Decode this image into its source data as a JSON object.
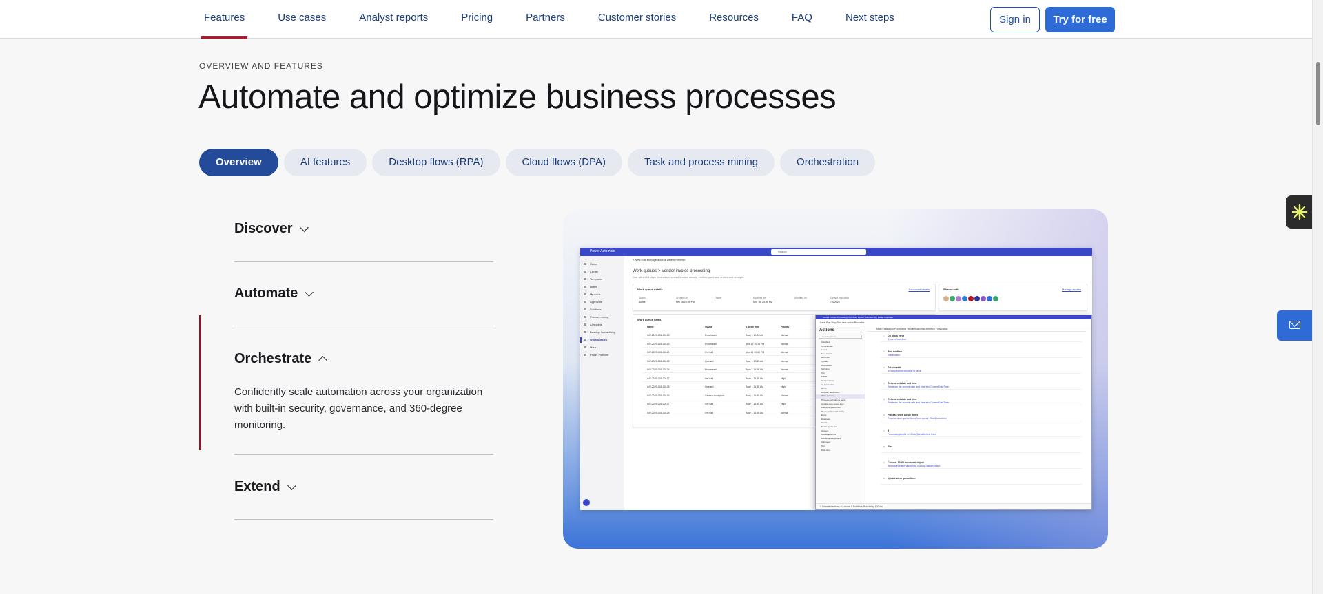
{
  "nav": {
    "links": [
      "Features",
      "Use cases",
      "Analyst reports",
      "Pricing",
      "Partners",
      "Customer stories",
      "Resources",
      "FAQ",
      "Next steps"
    ],
    "active": "Features",
    "signin_label": "Sign in",
    "try_label": "Try for free"
  },
  "hero": {
    "eyebrow": "OVERVIEW AND FEATURES",
    "title": "Automate and optimize business processes"
  },
  "tabs": {
    "items": [
      "Overview",
      "AI features",
      "Desktop flows (RPA)",
      "Cloud flows (DPA)",
      "Task and process mining",
      "Orchestration"
    ],
    "active": "Overview"
  },
  "accordion": {
    "items": [
      {
        "title": "Discover",
        "open": false
      },
      {
        "title": "Automate",
        "open": false
      },
      {
        "title": "Orchestrate",
        "open": true,
        "body": "Confidently scale automation across your organization with built-in security, governance, and 360-degree monitoring."
      },
      {
        "title": "Extend",
        "open": false
      }
    ]
  },
  "screenshot": {
    "app_name": "Power Automate",
    "search_placeholder": "Search",
    "toolbar": "+ New   Edit   Manage access   Delete   Refresh",
    "breadcrumb": "Work queues  >  Vendor invoice processing",
    "breadcrumb_sub": "Due within 14 days. Includes received invoice details, verified purchase orders and receipts.",
    "sidebar": [
      "Home",
      "Create",
      "Templates",
      "Learn",
      "My flows",
      "Approvals",
      "Solutions",
      "Process mining",
      "AI models",
      "Desktop flow activity",
      "Work queues",
      "More",
      "Power Platform"
    ],
    "sidebar_selected": "Work queues",
    "details_title": "Work queue details",
    "details_link": "Advanced details",
    "shared_title": "Shared with",
    "shared_link": "Manage access",
    "details": [
      {
        "label": "Status",
        "value": "Active"
      },
      {
        "label": "Created on",
        "value": "Feb 26 20:59 PM"
      },
      {
        "label": "Owner",
        "value": ""
      },
      {
        "label": "Modified on",
        "value": "Nov 7th 23:35 PM"
      },
      {
        "label": "Modified by",
        "value": ""
      },
      {
        "label": "Default expiration",
        "value": "7/4/2023"
      }
    ],
    "items_title": "Work queue items",
    "columns": [
      "Name",
      "Status",
      "Queue time",
      "Priority"
    ],
    "rows": [
      [
        "INV-2023-001-00123",
        "Processed",
        "May 1 10:06 AM",
        "Normal"
      ],
      [
        "INV-2023-001-00123",
        "Processed",
        "Apr 15 10:15 PM",
        "Normal"
      ],
      [
        "INV-2023-001-00124",
        "On hold",
        "Apr 16 10:40 PM",
        "Normal"
      ],
      [
        "INV-2023-001-00125",
        "Queued",
        "May 1 10:45 AM",
        "Normal"
      ],
      [
        "INV-2023-001-00126",
        "Processed",
        "May 1 11:06 AM",
        "Normal"
      ],
      [
        "INV-2023-001-00127",
        "On hold",
        "May 1 11:45 AM",
        "High"
      ],
      [
        "INV-2023-001-00128",
        "Queued",
        "May 1 11:45 AM",
        "High"
      ],
      [
        "INV-2023-001-00129",
        "Generic exception",
        "May 1 11:45 AM",
        "Normal"
      ],
      [
        "INV-2023-001-00127",
        "On hold",
        "May 1 11:45 AM",
        "High"
      ],
      [
        "INV-2023-001-00128",
        "On hold",
        "May 1 11:45 AM",
        "Normal"
      ]
    ],
    "share_colors": [
      "#d9b48a",
      "#3aa86b",
      "#b07bd6",
      "#2e7cd6",
      "#b3172a",
      "#2e2e8f",
      "#8a5cc4",
      "#2f6bd6",
      "#3aa86b"
    ]
  },
  "designer": {
    "title": "Vendor Invoice Processing from Work Queue (Subflow v3) | Power Automate",
    "menu": "File   Edit   Debug   Tools   View   Help",
    "toolbar": "Save   Run   Stop   Run next action   Recorder",
    "actions_title": "Actions",
    "actions_search": "Search actions",
    "action_items": [
      "Variables",
      "Conditionals",
      "Loops",
      "Flow control",
      "Run flow",
      "System",
      "Workstation",
      "Scripting",
      "File",
      "Folder",
      "Compression",
      "UI automation",
      "HTTP",
      "Browser automation",
      "Work queues",
      "Process work queue items",
      "Update work queue item",
      "Add work queue item",
      "Requeue item with delay",
      "Excel",
      "Database",
      "Email",
      "Exchange Server",
      "Outlook",
      "Message boxes",
      "Mouse and keyboard",
      "Clipboard",
      "Text",
      "Date time"
    ],
    "actions_selected": "Work queues",
    "flow_tabs": "Main    Evaluation    Processing    HandleBusinessException    Finalization",
    "steps": [
      {
        "title": "On block error",
        "sub": "SystemException"
      },
      {
        "title": "Run subflow",
        "sub": "Initialization"
      },
      {
        "title": "Set variable",
        "sub": "IsExceptionInExecution to false"
      },
      {
        "title": "Get current date and time",
        "sub": "Retrieves the current date and time into CurrentDateTime"
      },
      {
        "title": "Get current date and time",
        "sub": "Retrieves the current date and time into CurrentDateTime"
      },
      {
        "title": "Process work queue items",
        "sub": "Process work queue items from queue WorkQueueItem"
      },
      {
        "title": "If",
        "sub": "ProcessingItemId <> WorkQueueItem.Id then"
      },
      {
        "title": "Else",
        "sub": ""
      },
      {
        "title": "Convert JSON to custom object",
        "sub": "WorkQueueItem.Value into JsonAsCustomObject"
      },
      {
        "title": "Update work queue item",
        "sub": ""
      }
    ],
    "status": "0 Selected actions   0 Actions   0 Subflows   Run delay 100 ms",
    "ready": "Status: Ready"
  },
  "widgets": {
    "copilot": "copilot-sparkle-icon",
    "mail": "mail-icon"
  }
}
